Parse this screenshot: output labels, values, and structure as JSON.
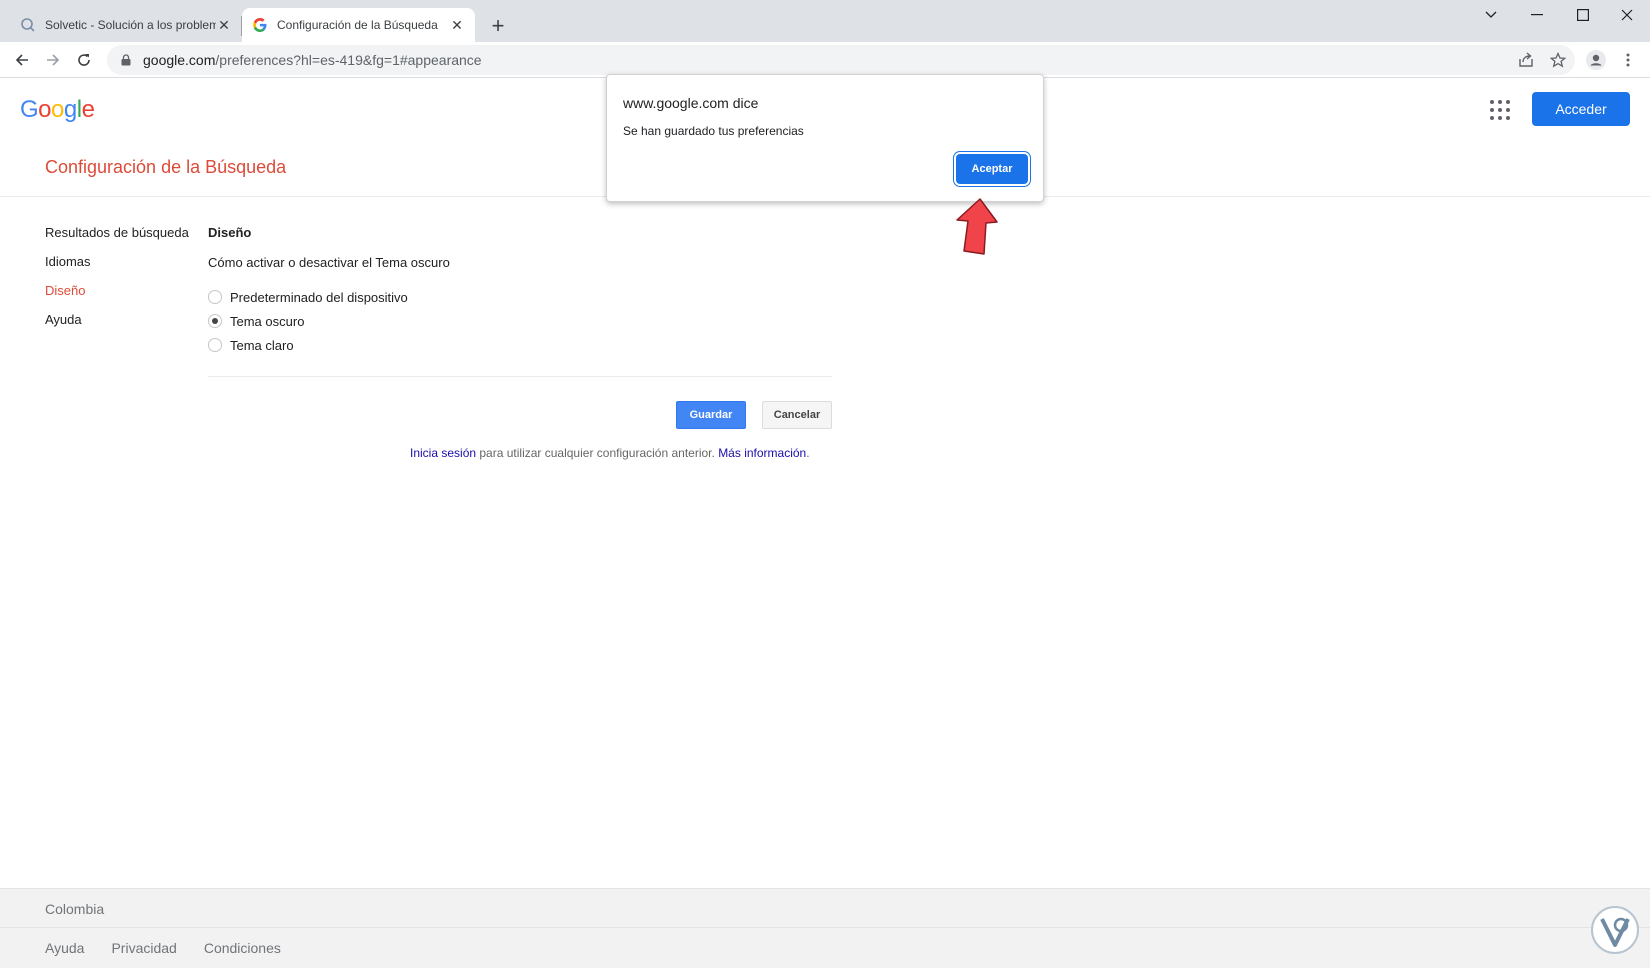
{
  "browser": {
    "tabs": [
      {
        "title": "Solvetic - Solución a los problemas",
        "active": false
      },
      {
        "title": "Configuración de la Búsqueda",
        "active": true
      }
    ],
    "url_host": "google.com",
    "url_path": "/preferences?hl=es-419&fg=1#appearance"
  },
  "header": {
    "logo_letters": [
      "G",
      "o",
      "o",
      "g",
      "l",
      "e"
    ],
    "logo_colors": [
      "#4285f4",
      "#ea4335",
      "#fbbc05",
      "#4285f4",
      "#34a853",
      "#ea4335"
    ],
    "signin_label": "Acceder"
  },
  "page": {
    "title": "Configuración de la Búsqueda",
    "nav": [
      "Resultados de búsqueda",
      "Idiomas",
      "Diseño",
      "Ayuda"
    ],
    "active_nav": "Diseño",
    "section_title": "Diseño",
    "section_subtitle": "Cómo activar o desactivar el Tema oscuro",
    "options": [
      {
        "label": "Predeterminado del dispositivo",
        "selected": false
      },
      {
        "label": "Tema oscuro",
        "selected": true
      },
      {
        "label": "Tema claro",
        "selected": false
      }
    ],
    "save_label": "Guardar",
    "cancel_label": "Cancelar",
    "note_link1": "Inicia sesión",
    "note_text": " para utilizar cualquier configuración anterior. ",
    "note_link2": "Más información",
    "note_end": "."
  },
  "footer": {
    "country": "Colombia",
    "links": [
      "Ayuda",
      "Privacidad",
      "Condiciones"
    ]
  },
  "dialog": {
    "title": "www.google.com dice",
    "message": "Se han guardado tus preferencias",
    "ok_label": "Aceptar"
  },
  "colors": {
    "accent": "#1a73e8",
    "title_red": "#dd4b39",
    "arrow": "#f0434a"
  }
}
